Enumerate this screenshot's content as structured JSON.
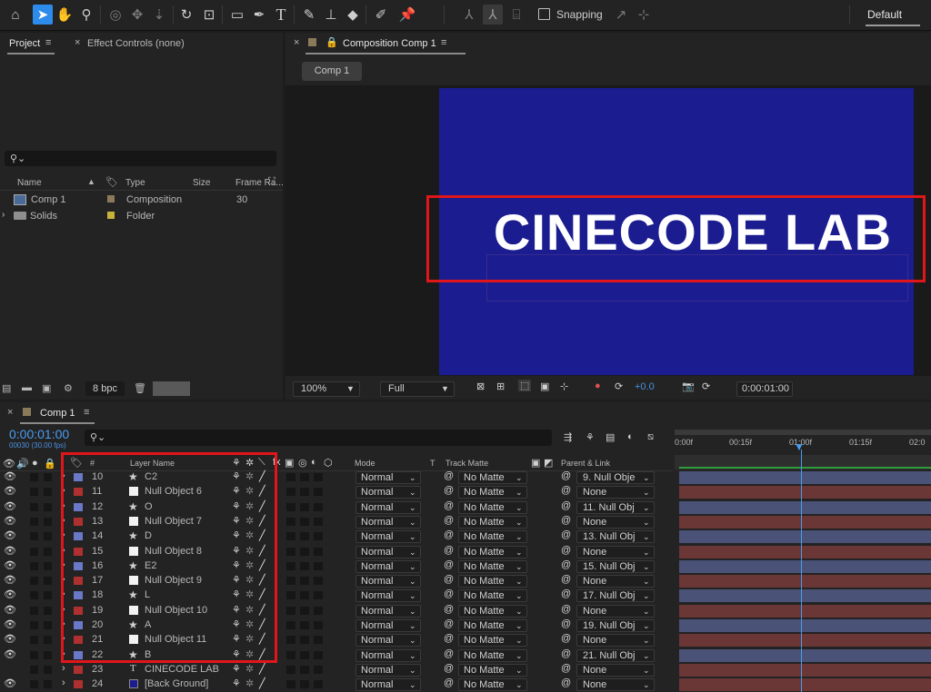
{
  "toolbar": {
    "tools": [
      "home-icon",
      "selection-arrow-icon",
      "hand-icon",
      "zoom-icon",
      "orbit-camera-icon",
      "pan-camera-icon",
      "dolly-camera-icon",
      "rotate-icon",
      "pan-behind-icon",
      "rectangle-icon",
      "pen-icon",
      "type-icon",
      "brush-icon",
      "clone-stamp-icon",
      "eraser-icon",
      "roto-brush-icon",
      "puppet-pin-icon"
    ],
    "snapping_label": "Snapping",
    "workspace_label": "Default"
  },
  "project_panel": {
    "tab_project": "Project",
    "tab_effect_controls": "Effect Controls (none)",
    "columns": {
      "name": "Name",
      "type": "Type",
      "size": "Size",
      "frame_rate": "Frame Ra..."
    },
    "items": [
      {
        "name": "Comp 1",
        "type": "Composition",
        "frame_rate": "30",
        "color": "#8a7a5a"
      },
      {
        "name": "Solids",
        "type": "Folder",
        "frame_rate": "",
        "color": "#c8b33a"
      }
    ],
    "bpc": "8 bpc"
  },
  "composition_panel": {
    "tab_label": "Composition Comp 1",
    "comp_button": "Comp 1",
    "viewer_text": "CINECODE LAB",
    "zoom": "100%",
    "resolution": "Full",
    "exposure": "+0.0",
    "timecode": "0:00:01:00",
    "bg_color": "#1b1c8f"
  },
  "timeline_panel": {
    "tab_label": "Comp 1",
    "current_time": "0:00:01:00",
    "frame_info": "00030 (30.00 fps)",
    "columns": {
      "num": "#",
      "layer_name": "Layer Name",
      "mode": "Mode",
      "t": "T",
      "track_matte": "Track Matte",
      "parent": "Parent & Link"
    },
    "ruler": [
      "0:00f",
      "00:15f",
      "01:00f",
      "01:15f",
      "02:0"
    ],
    "layers": [
      {
        "num": "10",
        "name": "C2",
        "kind": "star",
        "label": "#6a78c8",
        "mode": "Normal",
        "matte": "No Matte",
        "parent": "9. Null Obje",
        "bar": "#4a5277"
      },
      {
        "num": "11",
        "name": "Null Object 6",
        "kind": "null",
        "label": "#b03030",
        "mode": "Normal",
        "matte": "No Matte",
        "parent": "None",
        "bar": "#6a3636"
      },
      {
        "num": "12",
        "name": "O",
        "kind": "star",
        "label": "#6a78c8",
        "mode": "Normal",
        "matte": "No Matte",
        "parent": "11. Null Obj",
        "bar": "#4a5277"
      },
      {
        "num": "13",
        "name": "Null Object 7",
        "kind": "null",
        "label": "#b03030",
        "mode": "Normal",
        "matte": "No Matte",
        "parent": "None",
        "bar": "#6a3636"
      },
      {
        "num": "14",
        "name": "D",
        "kind": "star",
        "label": "#6a78c8",
        "mode": "Normal",
        "matte": "No Matte",
        "parent": "13. Null Obj",
        "bar": "#4a5277"
      },
      {
        "num": "15",
        "name": "Null Object 8",
        "kind": "null",
        "label": "#b03030",
        "mode": "Normal",
        "matte": "No Matte",
        "parent": "None",
        "bar": "#6a3636"
      },
      {
        "num": "16",
        "name": "E2",
        "kind": "star",
        "label": "#6a78c8",
        "mode": "Normal",
        "matte": "No Matte",
        "parent": "15. Null Obj",
        "bar": "#4a5277"
      },
      {
        "num": "17",
        "name": "Null Object 9",
        "kind": "null",
        "label": "#b03030",
        "mode": "Normal",
        "matte": "No Matte",
        "parent": "None",
        "bar": "#6a3636"
      },
      {
        "num": "18",
        "name": "L",
        "kind": "star",
        "label": "#6a78c8",
        "mode": "Normal",
        "matte": "No Matte",
        "parent": "17. Null Obj",
        "bar": "#4a5277"
      },
      {
        "num": "19",
        "name": "Null Object 10",
        "kind": "null",
        "label": "#b03030",
        "mode": "Normal",
        "matte": "No Matte",
        "parent": "None",
        "bar": "#6a3636"
      },
      {
        "num": "20",
        "name": "A",
        "kind": "star",
        "label": "#6a78c8",
        "mode": "Normal",
        "matte": "No Matte",
        "parent": "19. Null Obj",
        "bar": "#4a5277"
      },
      {
        "num": "21",
        "name": "Null Object 11",
        "kind": "null",
        "label": "#b03030",
        "mode": "Normal",
        "matte": "No Matte",
        "parent": "None",
        "bar": "#6a3636"
      },
      {
        "num": "22",
        "name": "B",
        "kind": "star",
        "label": "#6a78c8",
        "mode": "Normal",
        "matte": "No Matte",
        "parent": "21. Null Obj",
        "bar": "#4a5277"
      },
      {
        "num": "23",
        "name": "CINECODE LAB",
        "kind": "text",
        "label": "#b03030",
        "mode": "Normal",
        "matte": "No Matte",
        "parent": "None",
        "bar": "#6a3636"
      },
      {
        "num": "24",
        "name": "[Back Ground]",
        "kind": "solid",
        "label": "#b03030",
        "mode": "Normal",
        "matte": "No Matte",
        "parent": "None",
        "bar": "#6a3636"
      }
    ]
  },
  "highlight_color": "#e0161b"
}
